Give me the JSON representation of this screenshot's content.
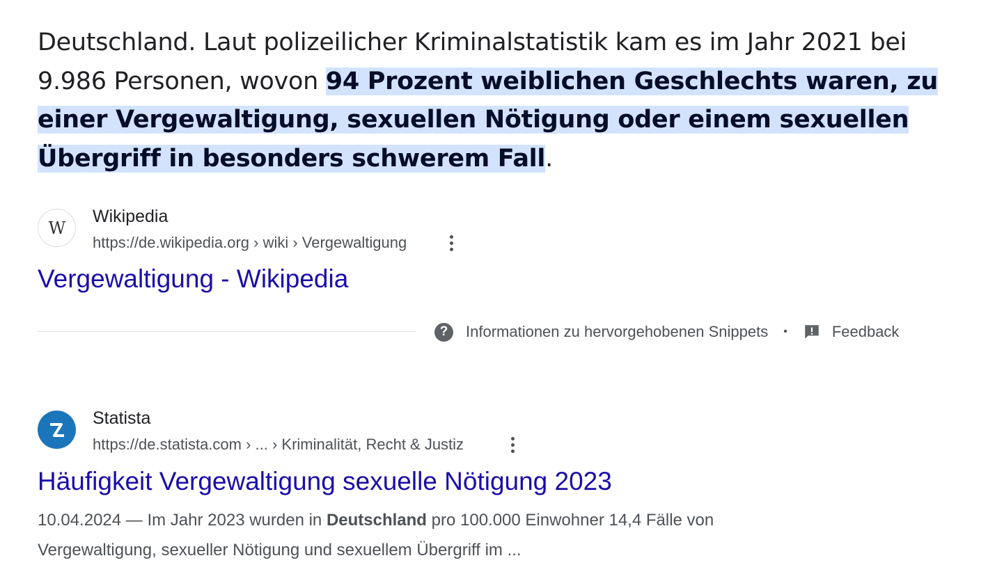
{
  "snippet": {
    "before_1": "Deutschland. Laut polizeilicher Kriminalstatistik kam es im Jahr 2021 bei",
    "before_2": "9.986 Personen, wovon ",
    "highlight_1": "94 Prozent weiblichen Geschlechts waren, zu",
    "highlight_2": "einer Vergewaltigung, sexuellen Nötigung oder einem sexuellen",
    "highlight_3": "Übergriff in besonders schwerem Fall",
    "after": "."
  },
  "featured_source": {
    "name": "Wikipedia",
    "url": "https://de.wikipedia.org › wiki › Vergewaltigung",
    "title": "Vergewaltigung - Wikipedia",
    "icon": "wikipedia-logo-icon"
  },
  "snippet_footer": {
    "about_label": "Informationen zu hervorgehobenen Snippets",
    "separator": "•",
    "feedback_label": "Feedback",
    "about_icon": "help-icon",
    "feedback_icon": "feedback-icon"
  },
  "result": {
    "name": "Statista",
    "url": "https://de.statista.com › ... › Kriminalität, Recht & Justiz",
    "title": "Häufigkeit Vergewaltigung sexuelle Nötigung 2023",
    "date": "10.04.2024",
    "dash": " — Im Jahr 2023 wurden in ",
    "bold_term": "Deutschland",
    "desc_rest": " pro 100.000 Einwohner 14,4 Fälle von",
    "desc_line2": "Vergewaltigung, sexueller Nötigung und sexuellem Übergriff im ...",
    "icon": "statista-logo-icon",
    "brand_color": "#1b75bb"
  },
  "colors": {
    "link": "#1a0dab",
    "highlight_bg": "#d3e3fd"
  }
}
